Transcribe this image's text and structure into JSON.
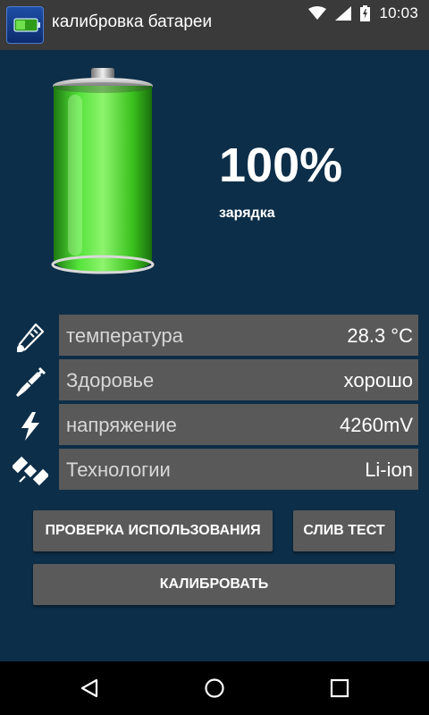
{
  "status": {
    "time": "10:03"
  },
  "app": {
    "title": "калибровка батареи"
  },
  "battery": {
    "percent": "100%",
    "state": "зарядка",
    "level": 1.0
  },
  "info_rows": [
    {
      "label": "температура",
      "value": "28.3 °C",
      "icon": "thermometer-icon"
    },
    {
      "label": "Здоровье",
      "value": "хорошо",
      "icon": "syringe-icon"
    },
    {
      "label": "напряжение",
      "value": "4260mV",
      "icon": "lightning-icon"
    },
    {
      "label": "Технологии",
      "value": "Li-ion",
      "icon": "satellite-icon"
    }
  ],
  "buttons": {
    "usage_check": "ПРОВЕРКА ИСПОЛЬЗОВАНИЯ",
    "drain_test": "СЛИВ ТЕСТ",
    "calibrate": "КАЛИБРОВАТЬ"
  },
  "colors": {
    "background": "#0d2e48",
    "row": "#595959",
    "battery_green": "#36d11b"
  }
}
